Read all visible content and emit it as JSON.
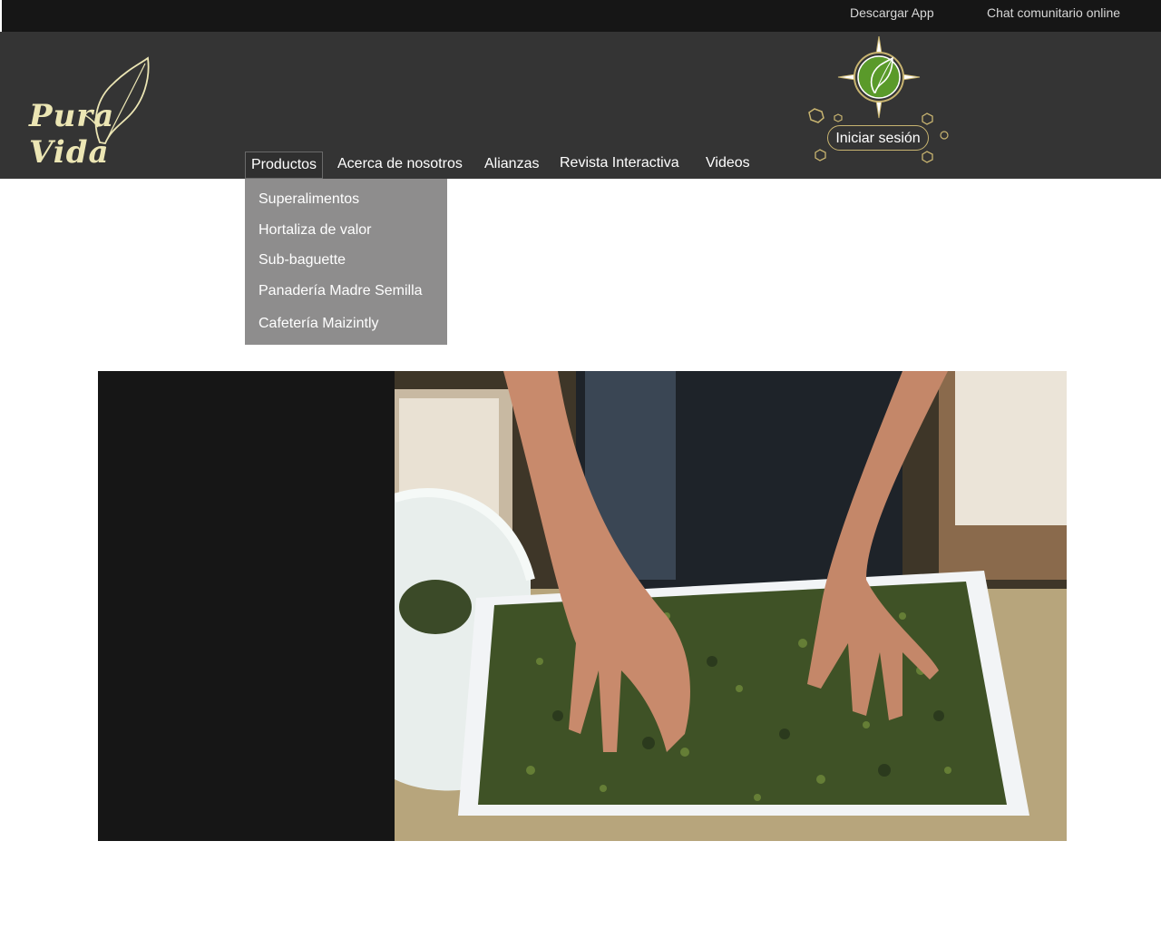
{
  "topbar": {
    "download_app": "Descargar App",
    "chat": "Chat comunitario online"
  },
  "brand": {
    "logo_text": "Pura Vida",
    "colors": {
      "logo": "#ece6b4",
      "header_bg": "#343434",
      "topbar_bg": "#161616",
      "accent_gold": "#c8b470",
      "leaf_green": "#5a9a2a"
    }
  },
  "nav": {
    "items": [
      {
        "label": "Productos"
      },
      {
        "label": "Acerca de nosotros"
      },
      {
        "label": "Alianzas"
      },
      {
        "label": "Revista Interactiva"
      },
      {
        "label": "Videos"
      }
    ]
  },
  "login": {
    "label": "Iniciar sesión"
  },
  "dropdown": {
    "items": [
      {
        "label": "Superalimentos"
      },
      {
        "label": "Hortaliza de valor"
      },
      {
        "label": "Sub-baguette"
      },
      {
        "label": "Panadería Madre Semilla"
      },
      {
        "label": "Cafetería Maizintly"
      }
    ]
  },
  "icons": {
    "compass": "compass-icon",
    "leaf": "leaf-icon"
  }
}
